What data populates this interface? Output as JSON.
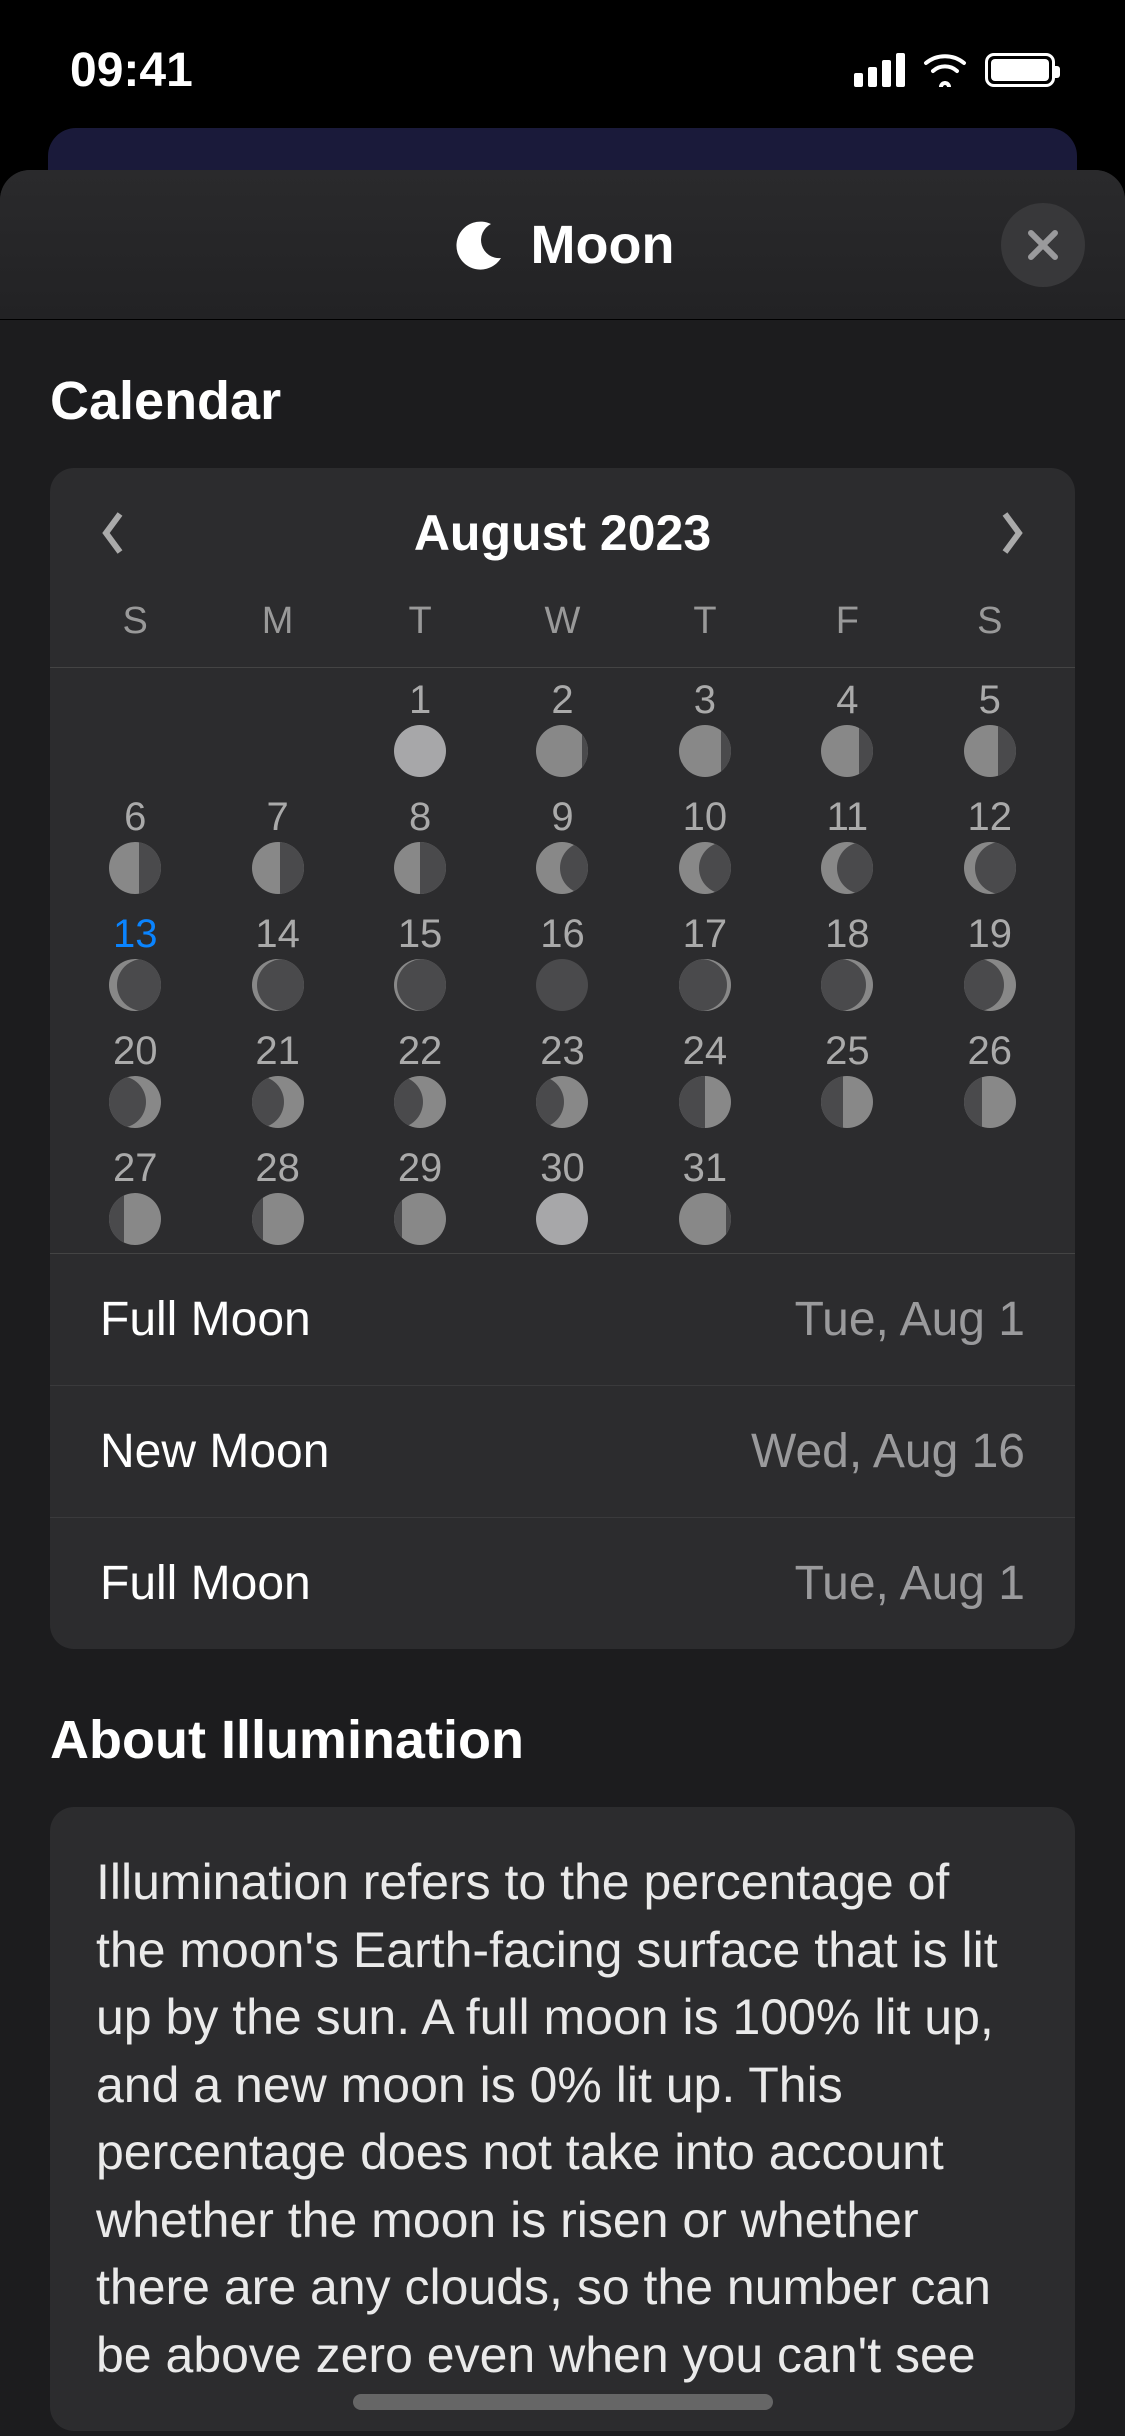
{
  "status": {
    "time": "09:41"
  },
  "header": {
    "title": "Moon"
  },
  "calendar": {
    "section_title": "Calendar",
    "month_label": "August 2023",
    "weekdays": [
      "S",
      "M",
      "T",
      "W",
      "T",
      "F",
      "S"
    ],
    "weeks": [
      [
        null,
        null,
        {
          "day": "1",
          "phase": "full",
          "amt": 0
        },
        {
          "day": "2",
          "phase": "waning-gibbous",
          "amt": 0.12
        },
        {
          "day": "3",
          "phase": "waning-gibbous",
          "amt": 0.2
        },
        {
          "day": "4",
          "phase": "waning-gibbous",
          "amt": 0.28
        },
        {
          "day": "5",
          "phase": "waning-gibbous",
          "amt": 0.35
        }
      ],
      [
        {
          "day": "6",
          "phase": "waning-gibbous",
          "amt": 0.42
        },
        {
          "day": "7",
          "phase": "waning-gibbous",
          "amt": 0.46
        },
        {
          "day": "8",
          "phase": "last-quarter",
          "amt": 0.5
        },
        {
          "day": "9",
          "phase": "waning-crescent",
          "amt": 0.55
        },
        {
          "day": "10",
          "phase": "waning-crescent",
          "amt": 0.62
        },
        {
          "day": "11",
          "phase": "waning-crescent",
          "amt": 0.7
        },
        {
          "day": "12",
          "phase": "waning-crescent",
          "amt": 0.78
        }
      ],
      [
        {
          "day": "13",
          "phase": "waning-crescent",
          "amt": 0.85,
          "today": true
        },
        {
          "day": "14",
          "phase": "waning-crescent",
          "amt": 0.9
        },
        {
          "day": "15",
          "phase": "waning-crescent",
          "amt": 0.95
        },
        {
          "day": "16",
          "phase": "new",
          "amt": 1
        },
        {
          "day": "17",
          "phase": "waxing-crescent",
          "amt": 0.92
        },
        {
          "day": "18",
          "phase": "waxing-crescent",
          "amt": 0.85
        },
        {
          "day": "19",
          "phase": "waxing-crescent",
          "amt": 0.78
        }
      ],
      [
        {
          "day": "20",
          "phase": "waxing-crescent",
          "amt": 0.7
        },
        {
          "day": "21",
          "phase": "waxing-crescent",
          "amt": 0.62
        },
        {
          "day": "22",
          "phase": "waxing-crescent",
          "amt": 0.56
        },
        {
          "day": "23",
          "phase": "waxing-crescent",
          "amt": 0.52
        },
        {
          "day": "24",
          "phase": "first-quarter",
          "amt": 0.5
        },
        {
          "day": "25",
          "phase": "waxing-gibbous",
          "amt": 0.42
        },
        {
          "day": "26",
          "phase": "waxing-gibbous",
          "amt": 0.35
        }
      ],
      [
        {
          "day": "27",
          "phase": "waxing-gibbous",
          "amt": 0.28
        },
        {
          "day": "28",
          "phase": "waxing-gibbous",
          "amt": 0.22
        },
        {
          "day": "29",
          "phase": "waxing-gibbous",
          "amt": 0.15
        },
        {
          "day": "30",
          "phase": "full",
          "amt": 0
        },
        {
          "day": "31",
          "phase": "waning-gibbous",
          "amt": 0.1
        },
        null,
        null
      ]
    ],
    "events": [
      {
        "label": "Full Moon",
        "date": "Tue, Aug 1"
      },
      {
        "label": "New Moon",
        "date": "Wed, Aug 16"
      },
      {
        "label": "Full Moon",
        "date": "Tue, Aug 1"
      }
    ]
  },
  "about": {
    "section_title": "About Illumination",
    "text": "Illumination refers to the percentage of the moon's Earth-facing surface that is lit up by the sun. A full moon is 100% lit up, and a new moon is 0% lit up. This percentage does not take into account whether the moon is risen or whether there are any clouds, so the number can be above zero even when you can't see"
  }
}
